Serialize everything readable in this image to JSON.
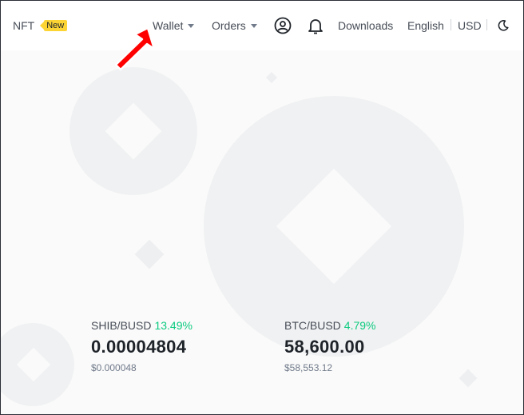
{
  "nav": {
    "nft_label": "NFT",
    "nft_badge": "New",
    "wallet_label": "Wallet",
    "orders_label": "Orders",
    "user_icon": "user-circle-icon",
    "bell_icon": "bell-icon",
    "downloads_label": "Downloads",
    "language_label": "English",
    "currency_label": "USD",
    "theme_icon": "moon-icon"
  },
  "tickers": [
    {
      "pair": "SHIB/BUSD",
      "change": "13.49%",
      "price": "0.00004804",
      "fiat": "$0.000048"
    },
    {
      "pair": "BTC/BUSD",
      "change": "4.79%",
      "price": "58,600.00",
      "fiat": "$58,553.12"
    }
  ],
  "colors": {
    "badge": "#fcd535",
    "positive": "#0ecb81",
    "annotation_arrow": "#ff0000"
  }
}
